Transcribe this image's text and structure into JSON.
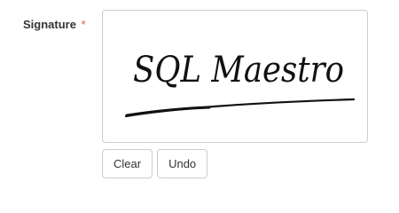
{
  "field": {
    "label": "Signature",
    "required_mark": "*"
  },
  "signature": {
    "handwritten_text": "SQL Maestro"
  },
  "buttons": {
    "clear_label": "Clear",
    "undo_label": "Undo"
  }
}
